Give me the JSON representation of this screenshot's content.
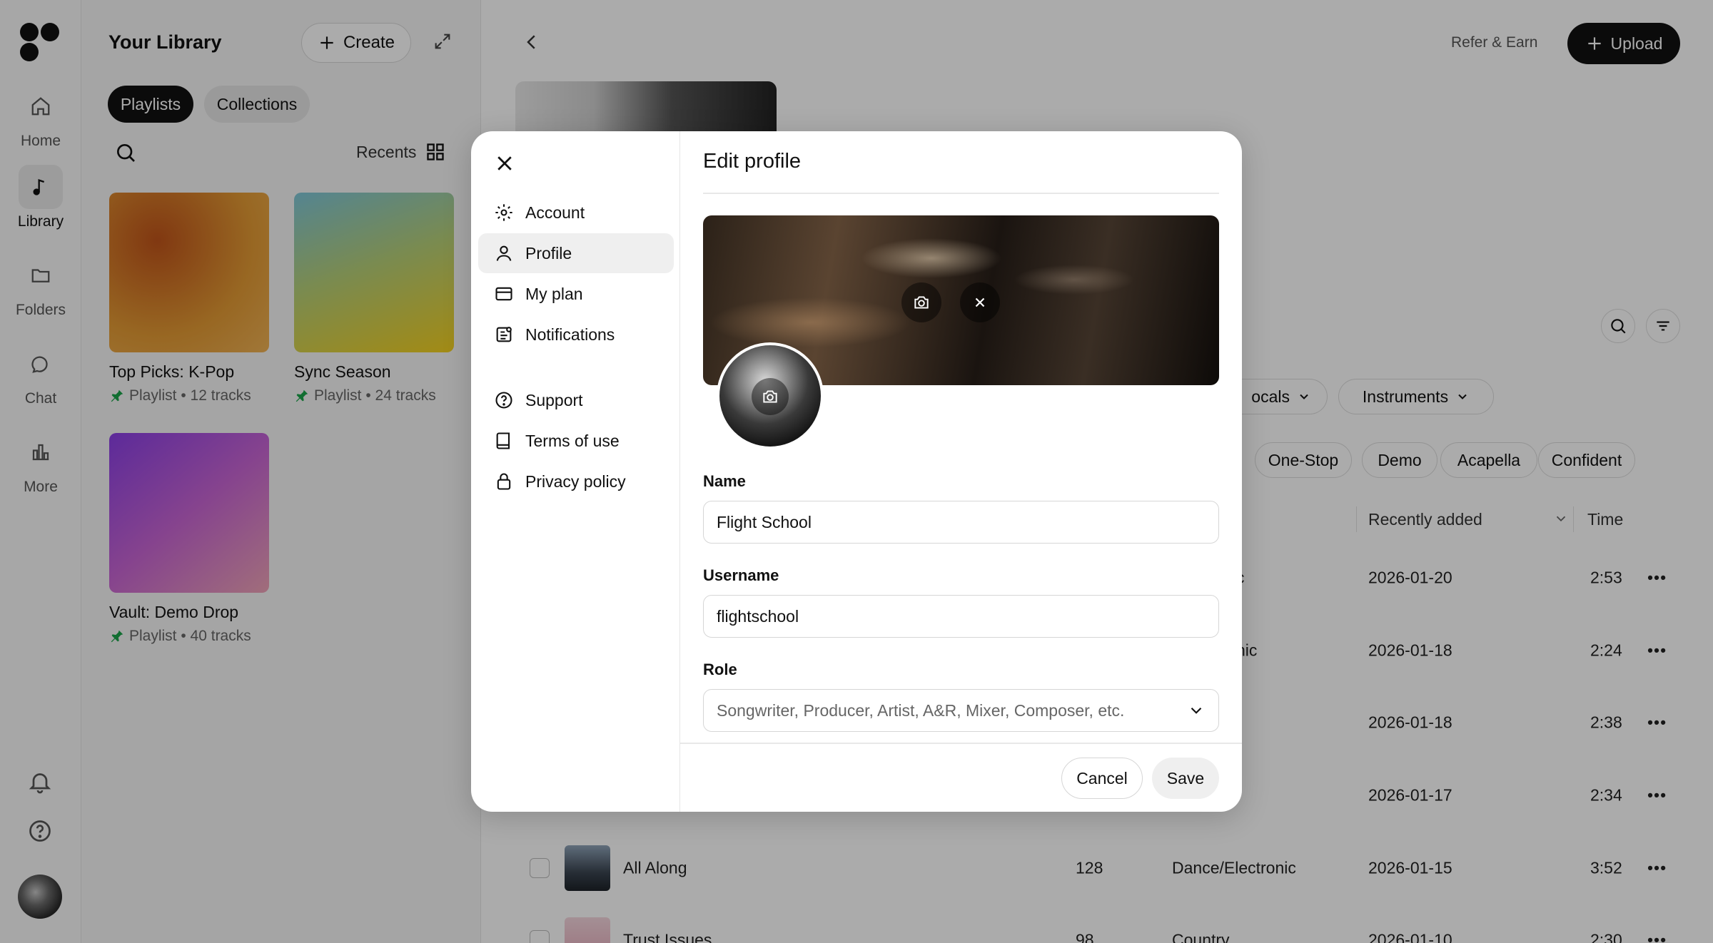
{
  "rail": {
    "items": [
      {
        "label": "Home"
      },
      {
        "label": "Library"
      },
      {
        "label": "Folders"
      },
      {
        "label": "Chat"
      },
      {
        "label": "More"
      }
    ]
  },
  "library": {
    "title": "Your Library",
    "create_label": "Create",
    "tabs": [
      "Playlists",
      "Collections"
    ],
    "sort_label": "Recents",
    "cards": [
      {
        "name": "Top Picks: K-Pop",
        "meta": "Playlist • 12 tracks"
      },
      {
        "name": "Sync Season",
        "meta": "Playlist • 24 tracks"
      },
      {
        "name": "Vault: Demo Drop",
        "meta": "Playlist • 40 tracks"
      }
    ]
  },
  "header": {
    "refer_label": "Refer & Earn",
    "upload_label": "Upload"
  },
  "filters": {
    "vocals_label": "ocals",
    "instruments_label": "Instruments",
    "tags": [
      "One-Stop",
      "Demo",
      "Acapella",
      "Confident"
    ]
  },
  "table": {
    "sort_label": "Recently added",
    "time_header": "Time",
    "rows": [
      {
        "title": "",
        "bpm": "",
        "genre": "c",
        "date": "2026-01-20",
        "time": "2:53"
      },
      {
        "title": "",
        "bpm": "",
        "genre": "nic",
        "date": "2026-01-18",
        "time": "2:24"
      },
      {
        "title": "",
        "bpm": "",
        "genre": "",
        "date": "2026-01-18",
        "time": "2:38"
      },
      {
        "title": "",
        "bpm": "",
        "genre": "",
        "date": "2026-01-17",
        "time": "2:34"
      },
      {
        "title": "All Along",
        "bpm": "128",
        "genre": "Dance/Electronic",
        "date": "2026-01-15",
        "time": "3:52"
      },
      {
        "title": "Trust Issues",
        "bpm": "98",
        "genre": "Country",
        "date": "2026-01-10",
        "time": "2:30"
      }
    ]
  },
  "modal": {
    "nav": [
      {
        "label": "Account",
        "icon": "gear-icon"
      },
      {
        "label": "Profile",
        "icon": "user-icon"
      },
      {
        "label": "My plan",
        "icon": "card-icon"
      },
      {
        "label": "Notifications",
        "icon": "notification-icon"
      },
      {
        "label": "Support",
        "icon": "help-icon"
      },
      {
        "label": "Terms of use",
        "icon": "book-icon"
      },
      {
        "label": "Privacy policy",
        "icon": "lock-icon"
      }
    ],
    "title": "Edit profile",
    "name_label": "Name",
    "name_value": "Flight School",
    "username_label": "Username",
    "username_value": "flightschool",
    "role_label": "Role",
    "role_placeholder": "Songwriter, Producer, Artist, A&R, Mixer, Composer, etc.",
    "cancel_label": "Cancel",
    "save_label": "Save"
  }
}
